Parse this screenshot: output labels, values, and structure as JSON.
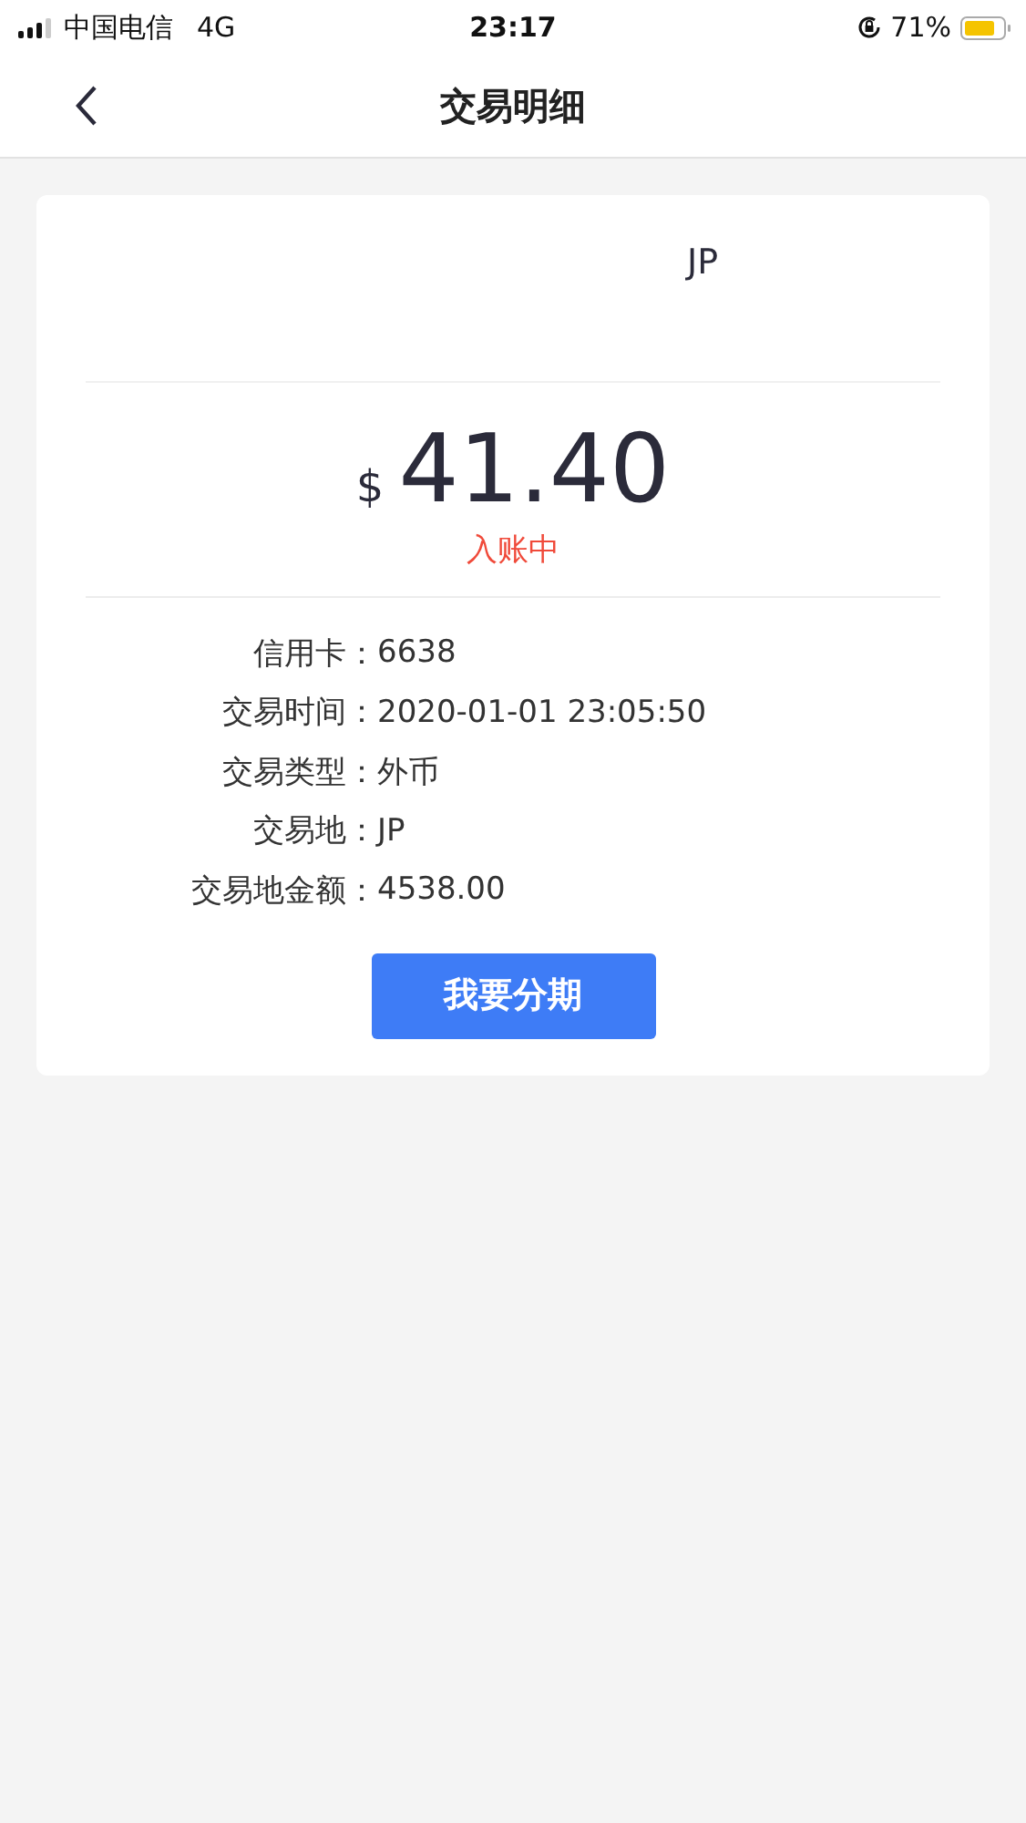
{
  "status_bar": {
    "carrier": "中国电信",
    "network": "4G",
    "time": "23:17",
    "battery": "71%"
  },
  "nav": {
    "title": "交易明细"
  },
  "card": {
    "merchant": "JP",
    "currency": "$",
    "amount": "41.40",
    "status": "入账中",
    "details": [
      {
        "label": "信用卡：",
        "value": "6638"
      },
      {
        "label": "交易时间：",
        "value": "2020-01-01 23:05:50"
      },
      {
        "label": "交易类型：",
        "value": "外币"
      },
      {
        "label": "交易地：",
        "value": "JP"
      },
      {
        "label": "交易地金额：",
        "value": "4538.00"
      }
    ],
    "button": "我要分期"
  }
}
